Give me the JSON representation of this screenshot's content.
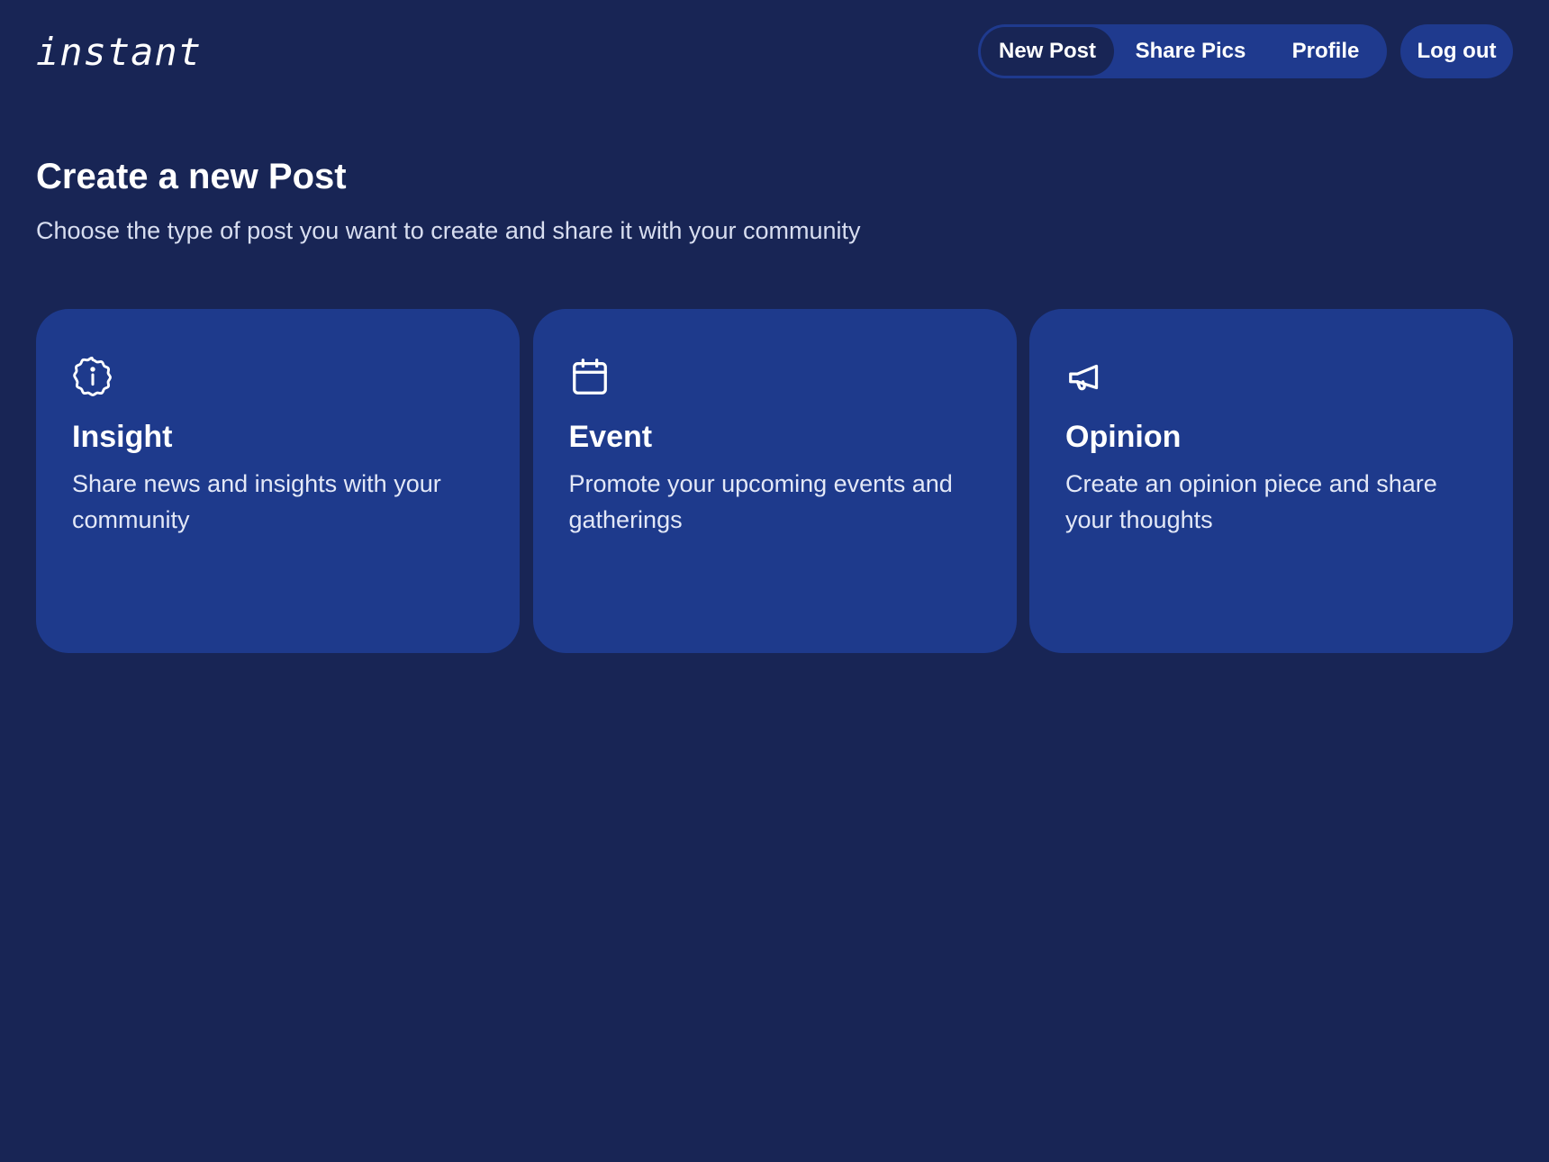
{
  "header": {
    "logo": "instant",
    "nav": [
      {
        "label": "New Post",
        "active": true
      },
      {
        "label": "Share Pics",
        "active": false
      },
      {
        "label": "Profile",
        "active": false
      }
    ],
    "logout_label": "Log out"
  },
  "main": {
    "title": "Create a new Post",
    "subtitle": "Choose the type of post you want to create and share it with your community",
    "cards": [
      {
        "icon": "info-badge-icon",
        "title": "Insight",
        "description": "Share news and insights with your community"
      },
      {
        "icon": "calendar-icon",
        "title": "Event",
        "description": "Promote your upcoming events and gatherings"
      },
      {
        "icon": "megaphone-icon",
        "title": "Opinion",
        "description": "Create an opinion piece and share your thoughts"
      }
    ]
  },
  "colors": {
    "background": "#182555",
    "card": "#1e3a8c",
    "nav_pill": "#1f3a8e"
  }
}
